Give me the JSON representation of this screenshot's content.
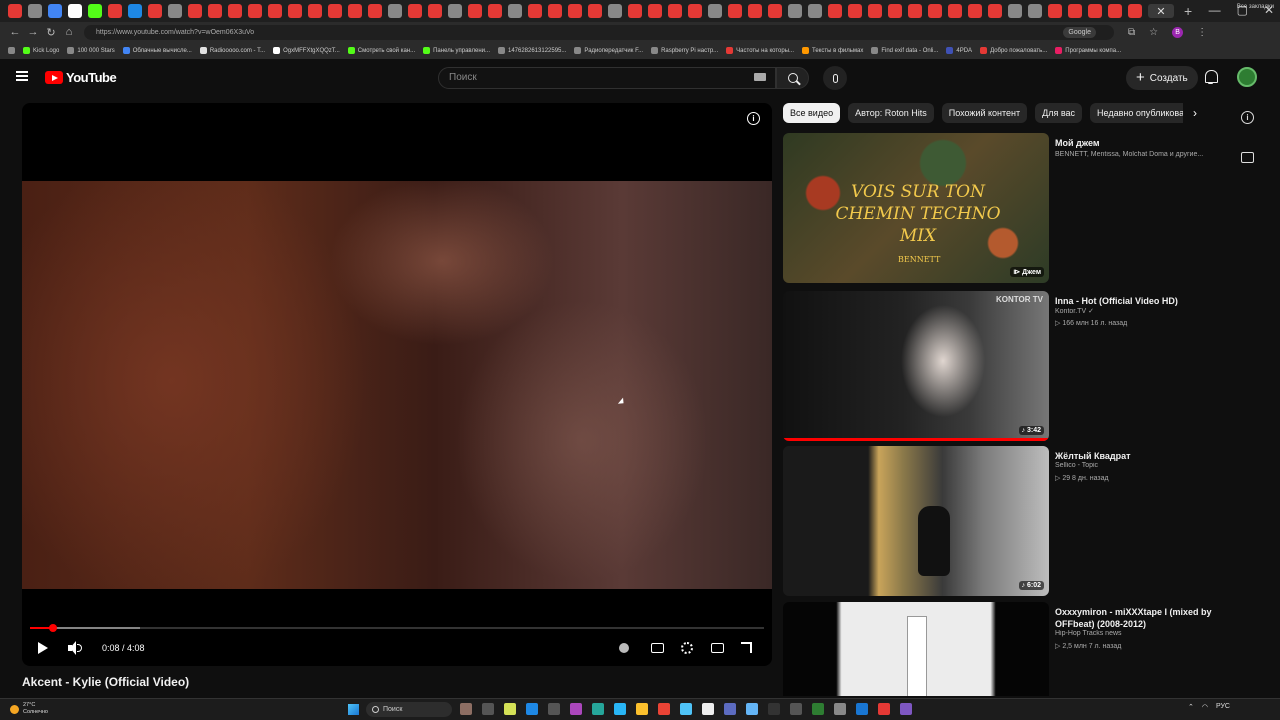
{
  "browser": {
    "url": "https://www.youtube.com/watch?v=wOem06X3uVo",
    "search_engine": "Google",
    "profile_letter": "B",
    "bookmarks": [
      {
        "label": "Kick Logo",
        "color": "#53fc18"
      },
      {
        "label": "100 000 Stars",
        "color": "#888888"
      },
      {
        "label": "Облачные вычисле...",
        "color": "#4285f4"
      },
      {
        "label": "Radiooooo.com - T...",
        "color": "#e0e0e0"
      },
      {
        "label": "OgxMFFXtgXQQzT...",
        "color": "#ffffff"
      },
      {
        "label": "Смотреть свой кан...",
        "color": "#53fc18"
      },
      {
        "label": "Панель управлени...",
        "color": "#53fc18"
      },
      {
        "label": "1476282613122595...",
        "color": "#888888"
      },
      {
        "label": "Радиопередатчик F...",
        "color": "#888888"
      },
      {
        "label": "Raspberry Pi настр...",
        "color": "#888888"
      },
      {
        "label": "Частоты на которы...",
        "color": "#e53935"
      },
      {
        "label": "Тексты в фильмах",
        "color": "#ff9800"
      },
      {
        "label": "Find exif data - Onli...",
        "color": "#888888"
      },
      {
        "label": "4PDA",
        "color": "#3f51b5"
      },
      {
        "label": "Добро пожаловать...",
        "color": "#e53935"
      },
      {
        "label": "Программы компа...",
        "color": "#e91e63"
      }
    ],
    "all_bookmarks_label": "Все закладки"
  },
  "header": {
    "logo_text": "YouTube",
    "search_placeholder": "Поиск",
    "create_label": "Создать"
  },
  "player": {
    "current_time": "0:08",
    "duration": "4:08",
    "time_display": "0:08 / 4:08",
    "progress_fraction": 0.032,
    "buffered_fraction": 0.15,
    "title": "Akcent - Kylie (Official Video)"
  },
  "chips": [
    {
      "label": "Все видео",
      "active": true
    },
    {
      "label": "Автор: Roton Hits",
      "active": false
    },
    {
      "label": "Похожий контент",
      "active": false
    },
    {
      "label": "Для вас",
      "active": false
    },
    {
      "label": "Недавно опубликова",
      "active": false
    }
  ],
  "recommendations": [
    {
      "title": "Мой джем",
      "channel": "BENNETT, Mentissa, Molchat Doma и другие...",
      "meta": "",
      "badge": "⧐ Джем",
      "thumb_text": "VOIS SUR TON CHEMIN TECHNO MIX",
      "thumb_sig": "BENNETT"
    },
    {
      "title": "Inna - Hot (Official Video HD)",
      "channel": "Kontor.TV ✓",
      "meta": "▷ 166 млн  16 л. назад",
      "badge": "♪ 3:42",
      "thumb_badge": "KONTOR TV",
      "watched_fraction": 1.0
    },
    {
      "title": "Жёлтый Квадрат",
      "channel": "Sellico - Topic",
      "meta": "▷ 29  8 дн. назад",
      "badge": "♪ 6:02"
    },
    {
      "title": "Oxxxymiron - miXXXtape I (mixed by OFFbeat) (2008-2012)",
      "channel": "Hip-Hop Tracks news",
      "meta": "▷ 2,5 млн  7 л. назад",
      "badge": ""
    }
  ],
  "taskbar": {
    "temperature": "27°C",
    "weather": "Солнечно",
    "search_label": "Поиск",
    "lang": "РУС"
  }
}
